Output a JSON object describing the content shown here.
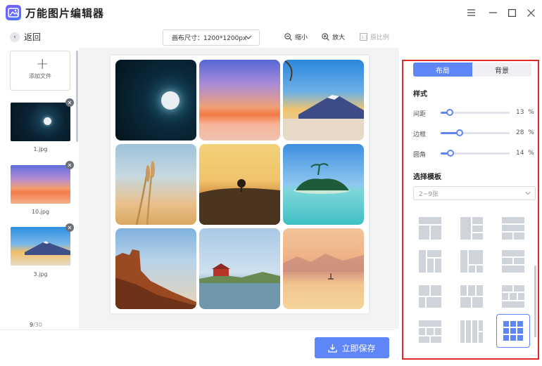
{
  "app": {
    "title": "万能图片编辑器",
    "window_controls": [
      "menu-icon",
      "minimize-icon",
      "maximize-icon",
      "close-icon"
    ]
  },
  "toolbar": {
    "back_label": "返回",
    "canvas_size": "画布尺寸：1200*1200px",
    "zoom_out_label": "缩小",
    "zoom_in_label": "放大",
    "original_ratio_label": "原比例"
  },
  "files": {
    "add_label": "添加文件",
    "items": [
      {
        "name": "1.jpg",
        "thumb": "moon-night"
      },
      {
        "name": "10.jpg",
        "thumb": "sunset-sea"
      },
      {
        "name": "3.jpg",
        "thumb": "mount-fuji"
      }
    ],
    "current_page": "9",
    "total_pages": "30",
    "page_separator": "/"
  },
  "canvas": {
    "tiles": [
      "moon-night",
      "sunset-sea",
      "mount-fuji",
      "wheat-field",
      "lone-tree",
      "tropical-island",
      "desert-canyon",
      "lakeside-house",
      "misty-lake"
    ]
  },
  "actions": {
    "save_label": "立即保存"
  },
  "right_panel": {
    "tabs": [
      {
        "label": "布局",
        "active": true
      },
      {
        "label": "背景",
        "active": false
      }
    ],
    "style_title": "样式",
    "sliders": [
      {
        "label": "间距",
        "value": 13,
        "unit": "%"
      },
      {
        "label": "边框",
        "value": 28,
        "unit": "%"
      },
      {
        "label": "圆角",
        "value": 14,
        "unit": "%"
      }
    ],
    "template_title": "选择模板",
    "template_select": "2~9张",
    "selected_template": 11
  },
  "colors": {
    "accent": "#5f86f7",
    "highlight_border": "#e12828",
    "template_block": "#cfd3da"
  }
}
